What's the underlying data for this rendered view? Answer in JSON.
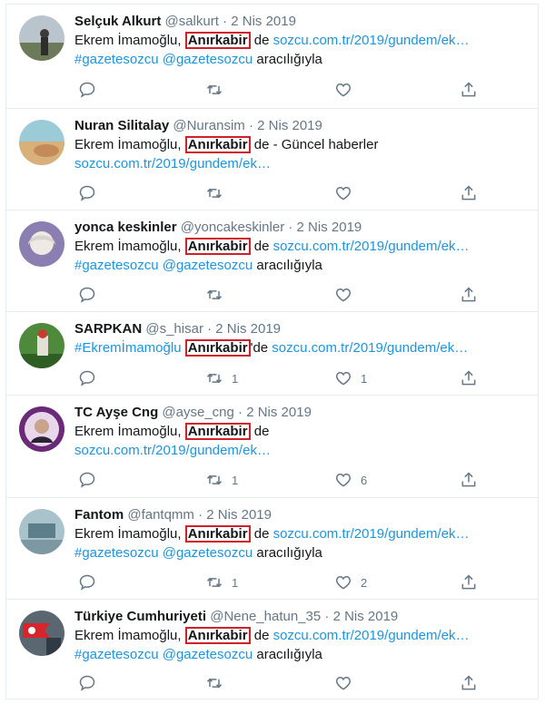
{
  "tweets": [
    {
      "name": "Selçuk Alkurt",
      "handle": "@salkurt",
      "date": "2 Nis 2019",
      "l1_pre": "Ekrem İmamoğlu, ",
      "l1_hl": "Anırkabir",
      "l1_post": " de ",
      "l1_link": "sozcu.com.tr/2019/gundem/ek…",
      "l2_tags": "#gazetesozcu @gazetesozcu",
      "l2_text": " aracılığıyla",
      "retweets": "",
      "likes": ""
    },
    {
      "name": "Nuran Silitalay",
      "handle": "@Nuransim",
      "date": "2 Nis 2019",
      "l1_pre": "Ekrem İmamoğlu, ",
      "l1_hl": "Anırkabir",
      "l1_post": " de - Güncel haberler",
      "l1_link": "",
      "l2_link": "sozcu.com.tr/2019/gundem/ek…",
      "retweets": "",
      "likes": ""
    },
    {
      "name": "yonca keskinler",
      "handle": "@yoncakeskinler",
      "date": "2 Nis 2019",
      "l1_pre": "Ekrem İmamoğlu, ",
      "l1_hl": "Anırkabir",
      "l1_post": " de ",
      "l1_link": "sozcu.com.tr/2019/gundem/ek…",
      "l2_tags": "#gazetesozcu @gazetesozcu",
      "l2_text": " aracılığıyla",
      "retweets": "",
      "likes": ""
    },
    {
      "name": "SARPKAN",
      "handle": "@s_hisar",
      "date": "2 Nis 2019",
      "l1_tag": "#Ekremİmamoğlu ",
      "l1_hl": "Anırkabir",
      "l1_post": "'de ",
      "l1_link": "sozcu.com.tr/2019/gundem/ek…",
      "retweets": "1",
      "likes": "1"
    },
    {
      "name": "TC Ayşe Cng",
      "handle": "@ayse_cng",
      "date": "2 Nis 2019",
      "l1_pre": "Ekrem İmamoğlu, ",
      "l1_hl": "Anırkabir",
      "l1_post": " de",
      "l1_link": "",
      "l2_link": "sozcu.com.tr/2019/gundem/ek…",
      "retweets": "1",
      "likes": "6"
    },
    {
      "name": "Fantom",
      "handle": "@fantqmm",
      "date": "2 Nis 2019",
      "l1_pre": "Ekrem İmamoğlu, ",
      "l1_hl": "Anırkabir",
      "l1_post": " de ",
      "l1_link": "sozcu.com.tr/2019/gundem/ek…",
      "l2_tags": "#gazetesozcu @gazetesozcu",
      "l2_text": " aracılığıyla",
      "retweets": "1",
      "likes": "2"
    },
    {
      "name": "Türkiye Cumhuriyeti",
      "handle": "@Nene_hatun_35",
      "date": "2 Nis 2019",
      "l1_pre": "Ekrem İmamoğlu, ",
      "l1_hl": "Anırkabir",
      "l1_post": " de ",
      "l1_link": "sozcu.com.tr/2019/gundem/ek…",
      "l2_tags": "#gazetesozcu @gazetesozcu",
      "l2_text": " aracılığıyla",
      "retweets": "",
      "likes": ""
    }
  ],
  "separator": " · ",
  "colors": {
    "link": "#1b95e0",
    "highlight_border": "#d0202a",
    "meta": "#657786",
    "divider": "#e6ecf0"
  },
  "icons": [
    "reply-icon",
    "retweet-icon",
    "like-icon",
    "share-icon"
  ]
}
